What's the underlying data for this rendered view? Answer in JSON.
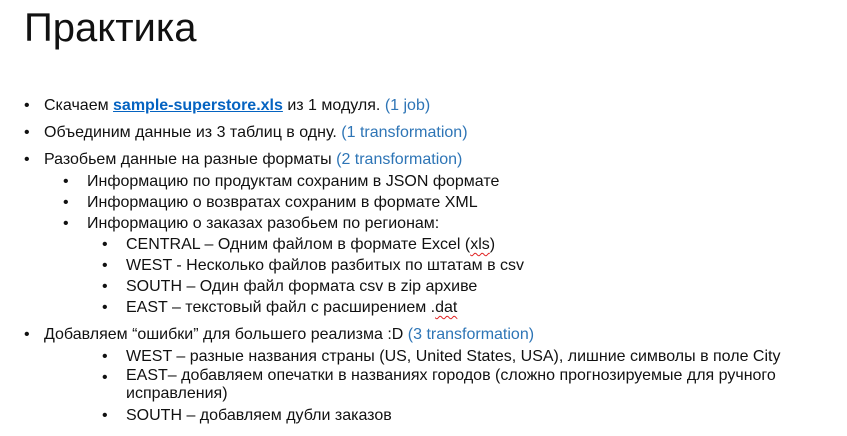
{
  "title": "Практика",
  "colors": {
    "link": "#0563C1",
    "accent": "#2E75B6",
    "text": "#111111"
  },
  "bullets": {
    "b1": {
      "pre": "Скачаем ",
      "link": "sample-superstore.xls",
      "mid": " из 1 модуля. ",
      "note": "(1 job)"
    },
    "b2": {
      "text": "Объединим данные из 3 таблиц в одну. ",
      "note": "(1 transformation)"
    },
    "b3": {
      "text": "Разобьем данные на разные форматы   ",
      "note": "(2 transformation)",
      "sub": [
        "Информацию по продуктам сохраним в JSON формате",
        "Информацию о возвратах сохраним в формате XML",
        "Информацию о заказах разобьем по регионам:"
      ],
      "regions": {
        "central_pre": "CENTRAL – Одним файлом в формате Excel (",
        "central_spell": "xls",
        "central_post": ")",
        "west": "WEST  -  Несколько  файлов разбитых по штатам в csv",
        "south": "SOUTH – Один файл формата csv в zip архиве",
        "east_pre": "EAST – текстовый файл с расширением .",
        "east_spell": "dat"
      }
    },
    "b4": {
      "text": "Добавляем “ошибки” для большего реализма :D ",
      "note": "(3 transformation)",
      "sub": [
        "WEST – разные названия страны (US, United States, USA), лишние символы в поле City",
        "EAST– добавляем опечатки в названиях городов (сложно прогнозируемые для ручного исправления)",
        "SOUTH – добавляем дубли заказов"
      ]
    }
  }
}
